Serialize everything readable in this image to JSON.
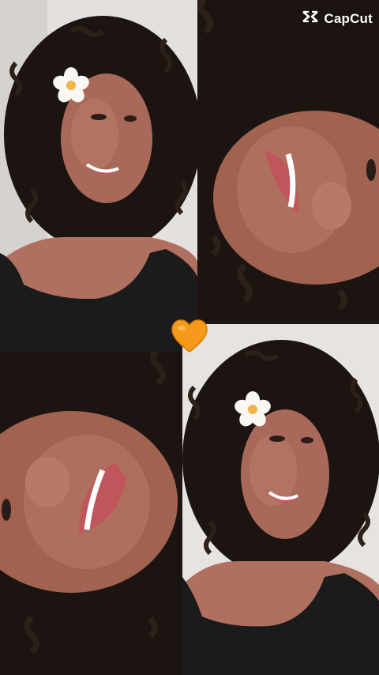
{
  "watermark": {
    "label": "CapCut",
    "icon": "capcut-logo-icon"
  },
  "overlay": {
    "emoji": "orange-heart-icon",
    "color": "#f59a1b"
  },
  "photos": [
    {
      "name": "photo-top-left",
      "description_icon": "portrait"
    },
    {
      "name": "photo-top-right",
      "description_icon": "portrait-rotated"
    },
    {
      "name": "photo-bottom-left",
      "description_icon": "portrait-rotated"
    },
    {
      "name": "photo-bottom-right",
      "description_icon": "portrait"
    }
  ],
  "colors": {
    "hair": "#1c1410",
    "skin": "#a86a55",
    "wall": "#e6e3e0",
    "top": "#1a1a1a",
    "lips": "#c0555c"
  }
}
